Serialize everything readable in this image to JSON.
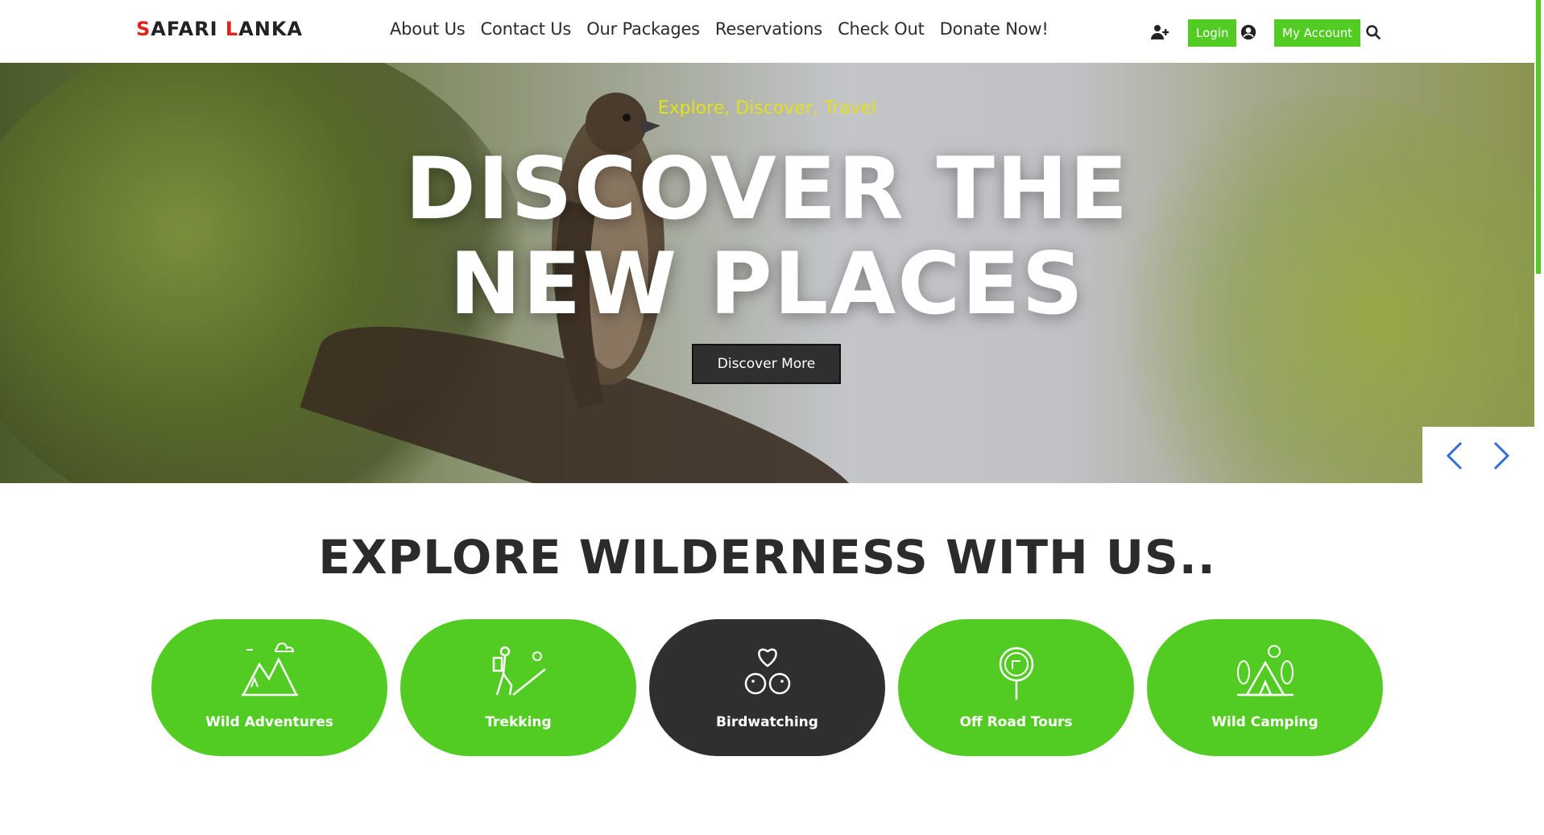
{
  "brand": {
    "logo_part1_initial": "S",
    "logo_part1_rest": "AFARI ",
    "logo_part2_initial": "L",
    "logo_part2_rest": "ANKA"
  },
  "nav": [
    {
      "label": "About Us"
    },
    {
      "label": "Contact Us"
    },
    {
      "label": "Our Packages"
    },
    {
      "label": "Reservations"
    },
    {
      "label": "Check Out"
    },
    {
      "label": "Donate Now!"
    }
  ],
  "header_actions": {
    "register_icon": "user-plus-icon",
    "login_label": "Login",
    "profile_icon": "user-circle-icon",
    "account_label": "My Account",
    "search_icon": "search-icon"
  },
  "hero": {
    "tagline": "Explore, Discover, Travel",
    "title_line1": "DISCOVER THE",
    "title_line2": "NEW PLACES",
    "cta_label": "Discover More",
    "prev_icon": "chevron-left-icon",
    "next_icon": "chevron-right-icon"
  },
  "explore": {
    "title": "EXPLORE WILDERNESS WITH US..",
    "cards": [
      {
        "label": "Wild Adventures",
        "icon": "mountains-icon",
        "active": false
      },
      {
        "label": "Trekking",
        "icon": "hiker-icon",
        "active": false
      },
      {
        "label": "Birdwatching",
        "icon": "birds-heart-icon",
        "active": true
      },
      {
        "label": "Off Road Tours",
        "icon": "signpost-icon",
        "active": false
      },
      {
        "label": "Wild Camping",
        "icon": "tent-icon",
        "active": false
      }
    ]
  },
  "colors": {
    "accent": "#52cc23",
    "dark": "#2f2f2f",
    "tagline": "#e4e019",
    "logo_red": "#e3211b"
  }
}
